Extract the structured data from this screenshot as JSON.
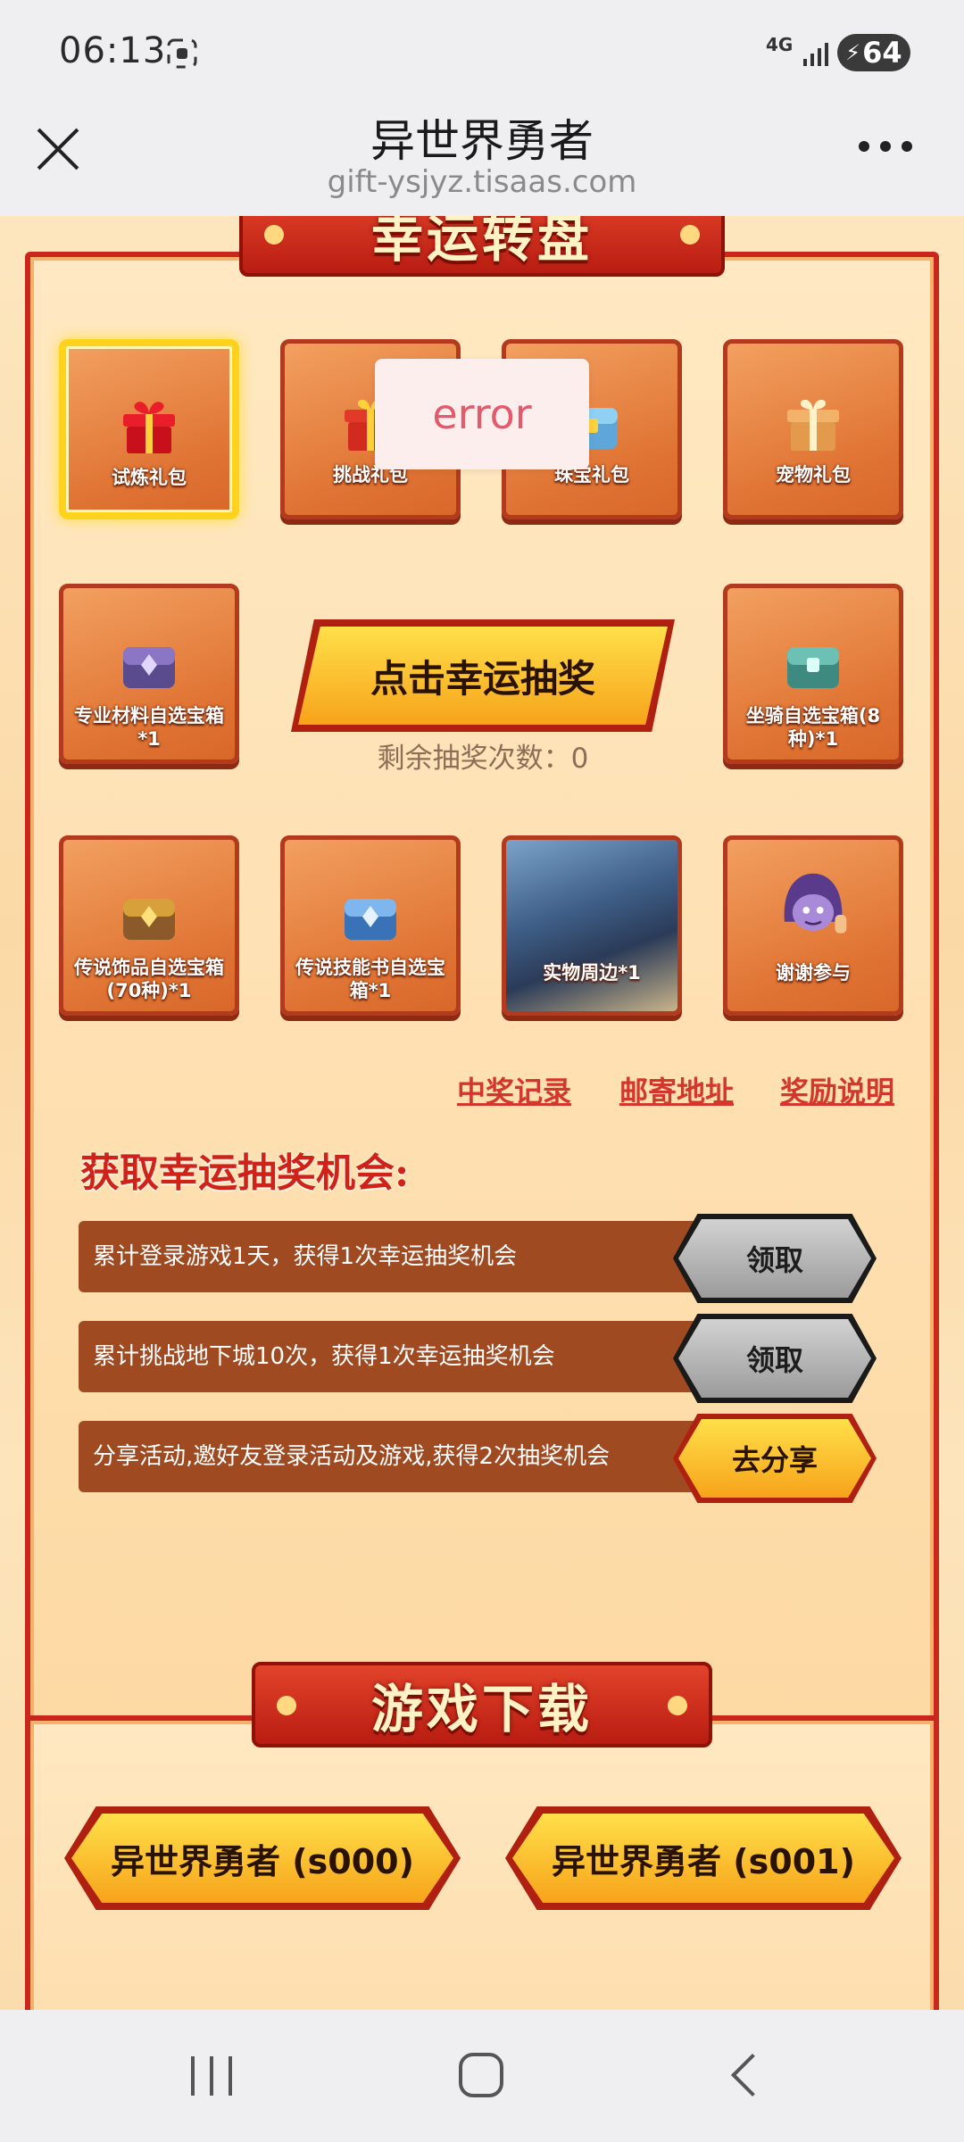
{
  "status_bar": {
    "time": "06:13",
    "network": "4G",
    "battery": "64"
  },
  "browser": {
    "title": "异世界勇者",
    "url": "gift-ysjyz.tisaas.com"
  },
  "lottery": {
    "banner": "幸运转盘",
    "prizes": [
      {
        "label": "试炼礼包",
        "icon": "red-gift-icon",
        "active": true
      },
      {
        "label": "挑战礼包",
        "icon": "gift-icon"
      },
      {
        "label": "珠宝礼包",
        "icon": "chest-icon"
      },
      {
        "label": "宠物礼包",
        "icon": "gift-box-icon"
      },
      {
        "label": "专业材料自选宝箱*1",
        "icon": "purple-chest-icon"
      },
      {
        "label": "坐骑自选宝箱(8种)*1",
        "icon": "teal-chest-icon"
      },
      {
        "label": "传说饰品自选宝箱(70种)*1",
        "icon": "gold-chest-icon"
      },
      {
        "label": "传说技能书自选宝箱*1",
        "icon": "blue-chest-icon"
      },
      {
        "label": "实物周边*1",
        "icon": "merch-photo"
      },
      {
        "label": "谢谢参与",
        "icon": "character-thumbs-up-icon"
      }
    ],
    "draw_button": "点击幸运抽奖",
    "remaining": "剩余抽奖次数：0",
    "links": {
      "records": "中奖记录",
      "address": "邮寄地址",
      "rules": "奖励说明"
    },
    "error_toast": "error"
  },
  "chances": {
    "heading": "获取幸运抽奖机会:",
    "tasks": [
      {
        "text": "累计登录游戏1天，获得1次幸运抽奖机会",
        "button": "领取"
      },
      {
        "text": "累计挑战地下城10次，获得1次幸运抽奖机会",
        "button": "领取"
      },
      {
        "text": "分享活动,邀好友登录活动及游戏,获得2次抽奖机会",
        "button": "去分享"
      }
    ]
  },
  "download": {
    "banner": "游戏下载",
    "buttons": [
      "异世界勇者 (s000)",
      "异世界勇者 (s001)"
    ]
  },
  "colors": {
    "banner_red": "#c9261c",
    "gold": "#f7a31a",
    "task_bg": "#a04a22"
  }
}
